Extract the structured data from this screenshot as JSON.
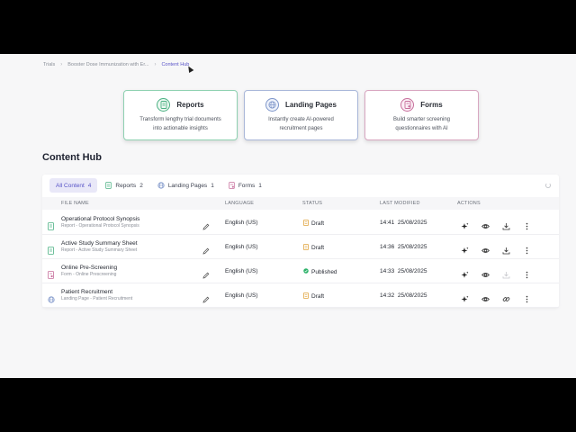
{
  "breadcrumb": [
    "Trials",
    "Booster Dose Immunization with Er...",
    "Content Hub"
  ],
  "cards": [
    {
      "title": "Reports",
      "desc1": "Transform lengthy trial documents",
      "desc2": "into actionable insights",
      "icon": "report-icon"
    },
    {
      "title": "Landing Pages",
      "desc1": "Instantly create AI-powered",
      "desc2": "recruitment pages",
      "icon": "globe-icon"
    },
    {
      "title": "Forms",
      "desc1": "Build smarter screening",
      "desc2": "questionnaires with AI",
      "icon": "form-icon"
    }
  ],
  "hub_title": "Content Hub",
  "tabs": [
    {
      "label": "All Content",
      "count": "4"
    },
    {
      "label": "Reports",
      "count": "2"
    },
    {
      "label": "Landing Pages",
      "count": "1"
    },
    {
      "label": "Forms",
      "count": "1"
    }
  ],
  "columns": {
    "file_name": "FILE NAME",
    "language": "LANGUAGE",
    "status": "STATUS",
    "last_modified": "LAST MODIFIED",
    "actions": "ACTIONS"
  },
  "rows": [
    {
      "name": "Operational Protocol Synopsis",
      "sub": "Report - Operational Protocol Synopsis",
      "lang": "English (US)",
      "status": "Draft",
      "time": "14:41",
      "date": "25/08/2025",
      "type": "report"
    },
    {
      "name": "Active Study Summary Sheet",
      "sub": "Report - Active Study Summary Sheet",
      "lang": "English (US)",
      "status": "Draft",
      "time": "14:36",
      "date": "25/08/2025",
      "type": "report"
    },
    {
      "name": "Online Pre-Screening",
      "sub": "Form - Online Prescreening",
      "lang": "English (US)",
      "status": "Published",
      "time": "14:33",
      "date": "25/08/2025",
      "type": "form"
    },
    {
      "name": "Patient Recruitment",
      "sub": "Landing Page - Patient Recruitment",
      "lang": "English (US)",
      "status": "Draft",
      "time": "14:32",
      "date": "25/08/2025",
      "type": "landing"
    }
  ],
  "colors": {
    "accent": "#5752c7",
    "reports": "#4bb183",
    "landing": "#7d95c9",
    "forms": "#c76f9c",
    "draft": "#e0a23a",
    "published": "#2fb36b"
  }
}
